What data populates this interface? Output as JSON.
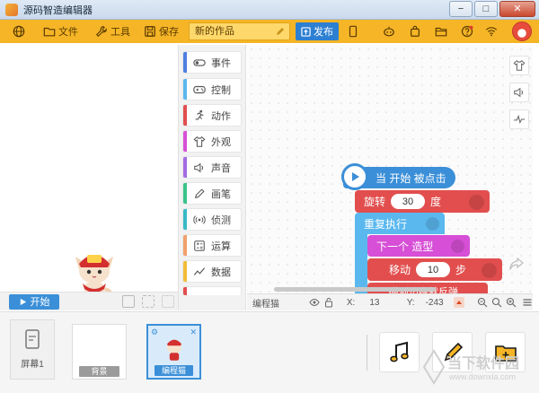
{
  "window": {
    "title": "源码智造编辑器",
    "controls": {
      "minimize": "−",
      "maximize": "□",
      "close": "✕"
    }
  },
  "toolbar": {
    "file_label": "文件",
    "tools_label": "工具",
    "save_label": "保存",
    "project_name": "新的作品",
    "publish_label": "发布",
    "right_icons": [
      "tablet-icon",
      "robot-icon",
      "bag-icon",
      "folder-icon",
      "help-icon",
      "wifi-icon"
    ],
    "colors": {
      "bar": "#f5b526",
      "publish": "#2d7fd1"
    }
  },
  "stage": {
    "start_label": "开始"
  },
  "palette": {
    "categories": [
      {
        "label": "事件",
        "icon": "toggle-icon",
        "color": "#4f7fe0"
      },
      {
        "label": "控制",
        "icon": "gamepad-icon",
        "color": "#5ab8ee"
      },
      {
        "label": "动作",
        "icon": "running-icon",
        "color": "#e24e4e"
      },
      {
        "label": "外观",
        "icon": "shirt-icon",
        "color": "#d64fd6"
      },
      {
        "label": "声音",
        "icon": "speaker-icon",
        "color": "#a36be3"
      },
      {
        "label": "画笔",
        "icon": "pen-icon",
        "color": "#39c489"
      },
      {
        "label": "侦测",
        "icon": "sensor-icon",
        "color": "#38b9c7"
      },
      {
        "label": "运算",
        "icon": "calculator-icon",
        "color": "#f2a06c"
      },
      {
        "label": "数据",
        "icon": "chart-icon",
        "color": "#f3bd3a"
      }
    ]
  },
  "script": {
    "hat_label": "当 开始 被点击",
    "rotate_label": "旋转",
    "rotate_value": "30",
    "rotate_unit": "度",
    "repeat_label": "重复执行",
    "next_costume_label": "下一个 造型",
    "move_label": "移动",
    "move_value": "10",
    "move_unit": "步",
    "partial_label": "碰到边缘就反弹",
    "colors": {
      "event": "#3b8fd8",
      "motion": "#e24e4e",
      "control": "#5ab8ee",
      "looks": "#d64fd6"
    }
  },
  "code_side_tools": [
    "shirt-icon",
    "speaker-icon",
    "pulse-icon"
  ],
  "coords": {
    "sprite_name": "编程猫",
    "x_label": "X:",
    "x_value": "13",
    "y_label": "Y:",
    "y_value": "-243"
  },
  "bottom": {
    "screen_label": "屏幕1",
    "background_label": "背景",
    "sprite_label": "编程猫",
    "watermark_text": "当下软件园",
    "watermark_url": "www.downxia.com"
  }
}
